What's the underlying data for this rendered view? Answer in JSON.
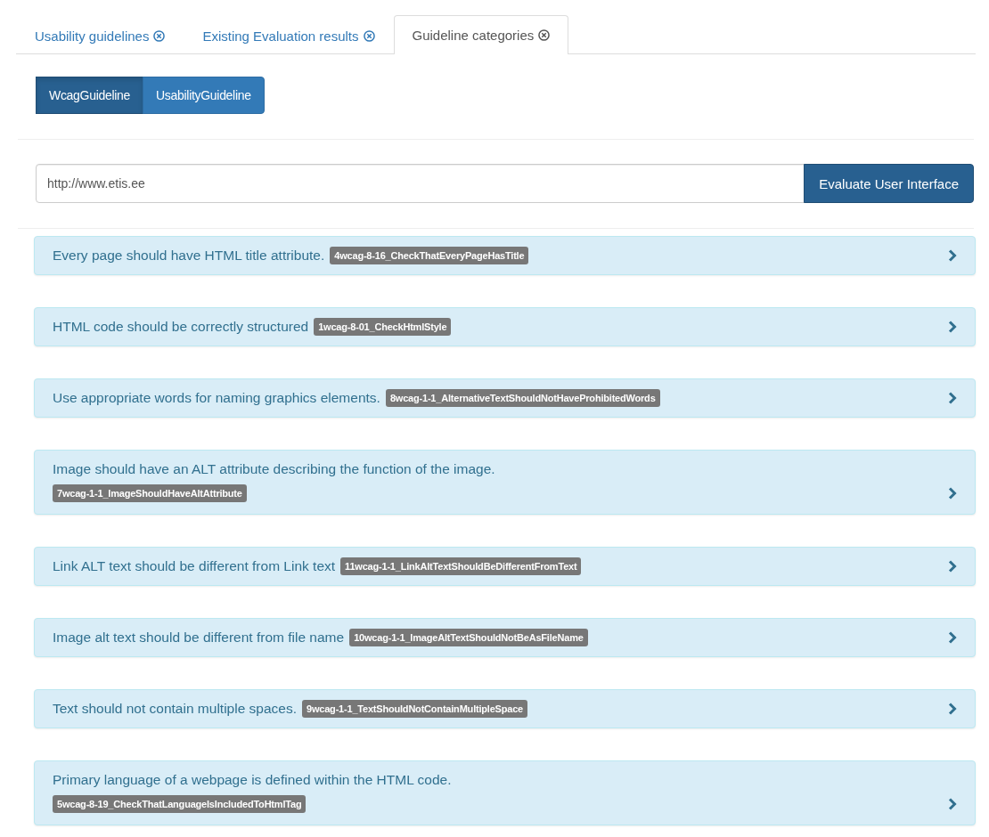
{
  "tabs": [
    {
      "label": "Usability guidelines",
      "selected": false
    },
    {
      "label": "Existing Evaluation results",
      "selected": false
    },
    {
      "label": "Guideline categories",
      "selected": true
    }
  ],
  "category_buttons": [
    {
      "label": "WcagGuideline",
      "selected": true
    },
    {
      "label": "UsabilityGuideline",
      "selected": false
    }
  ],
  "url_field": {
    "value": "http://www.etis.ee"
  },
  "evaluate_button": "Evaluate User Interface",
  "guidelines": [
    {
      "kind": "inline",
      "text": "Every page should have HTML title attribute.",
      "code": "4wcag-8-16_CheckThatEveryPageHasTitle"
    },
    {
      "kind": "inline",
      "text": "HTML code should be correctly structured",
      "code": "1wcag-8-01_CheckHtmlStyle"
    },
    {
      "kind": "inline",
      "text": "Use appropriate words for naming graphics elements.",
      "code": "8wcag-1-1_AlternativeTextShouldNotHaveProhibitedWords"
    },
    {
      "kind": "stacked",
      "text": "Image should have an ALT attribute describing the function of the image.",
      "code": "7wcag-1-1_ImageShouldHaveAltAttribute"
    },
    {
      "kind": "inline",
      "text": "Link ALT text should be different from Link text",
      "code": "11wcag-1-1_LinkAltTextShouldBeDifferentFromText"
    },
    {
      "kind": "inline",
      "text": "Image alt text should be different from file name",
      "code": "10wcag-1-1_ImageAltTextShouldNotBeAsFileName"
    },
    {
      "kind": "inline",
      "text": "Text should not contain multiple spaces.",
      "code": "9wcag-1-1_TextShouldNotContainMultipleSpace"
    },
    {
      "kind": "stacked",
      "text": "Primary language of a webpage is defined within the HTML code.",
      "code": "5wcag-8-19_CheckThatLanguageIsIncludedToHtmlTag"
    }
  ]
}
